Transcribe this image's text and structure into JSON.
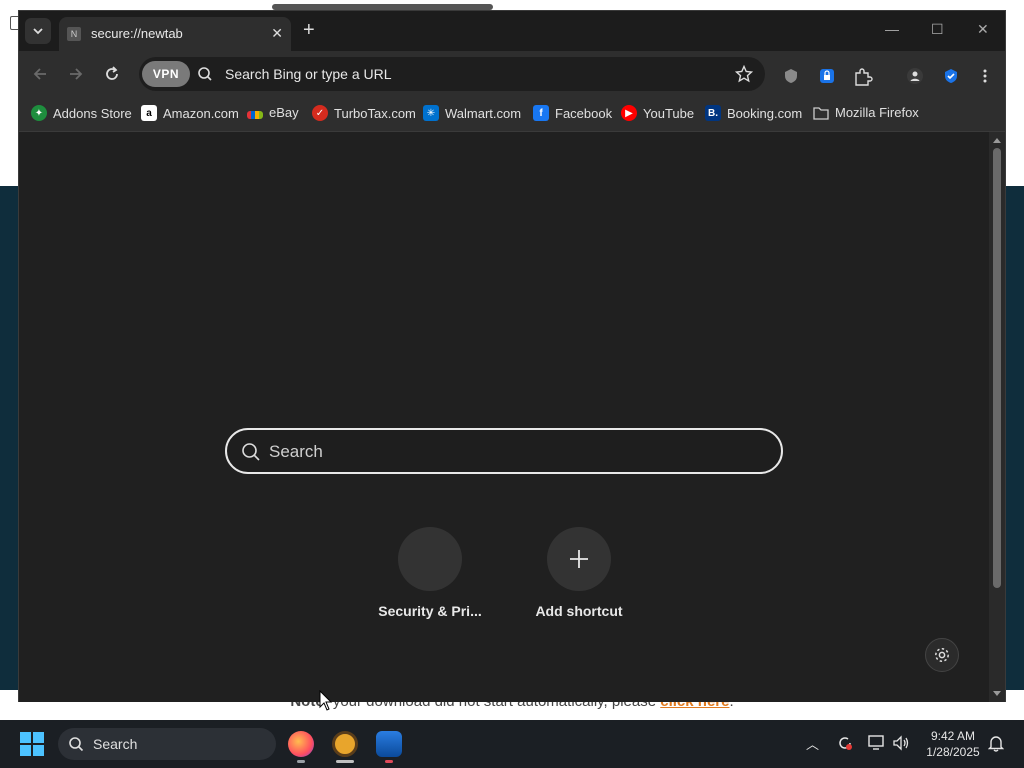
{
  "background": {
    "note_bold": "Note:",
    "note_text": " your download did not start automatically, please ",
    "note_link": "click here",
    "note_end": "."
  },
  "tab": {
    "favicon_letter": "N",
    "title": "secure://newtab"
  },
  "omnibox": {
    "vpn_label": "VPN",
    "placeholder": "Search Bing or type a URL"
  },
  "bookmarks": [
    {
      "label": "Addons Store",
      "icon": "addons-store-icon",
      "color": "#1e8e3e"
    },
    {
      "label": "Amazon.com",
      "icon": "amazon-icon",
      "color": "#ffffff"
    },
    {
      "label": "eBay",
      "icon": "ebay-icon",
      "color": "#e53238"
    },
    {
      "label": "TurboTax.com",
      "icon": "turbotax-icon",
      "color": "#d52b1e"
    },
    {
      "label": "Walmart.com",
      "icon": "walmart-icon",
      "color": "#0071ce"
    },
    {
      "label": "Facebook",
      "icon": "facebook-icon",
      "color": "#1877f2"
    },
    {
      "label": "YouTube",
      "icon": "youtube-icon",
      "color": "#ff0000"
    },
    {
      "label": "Booking.com",
      "icon": "booking-icon",
      "color": "#003580"
    },
    {
      "label": "Mozilla Firefox",
      "icon": "folder-icon",
      "color": "#cccccc"
    }
  ],
  "ntp": {
    "search_placeholder": "Search",
    "shortcuts": [
      {
        "label": "Security & Pri..."
      },
      {
        "label": "Add shortcut"
      }
    ]
  },
  "taskbar": {
    "search_label": "Search",
    "time": "9:42 AM",
    "date": "1/28/2025"
  },
  "colors": {
    "browser_bg": "#202020",
    "toolbar_bg": "#2e2e2e",
    "page_bg_dark": "#0f2d3c",
    "link_orange": "#e07a1f",
    "accent_blue": "#1a73e8"
  }
}
